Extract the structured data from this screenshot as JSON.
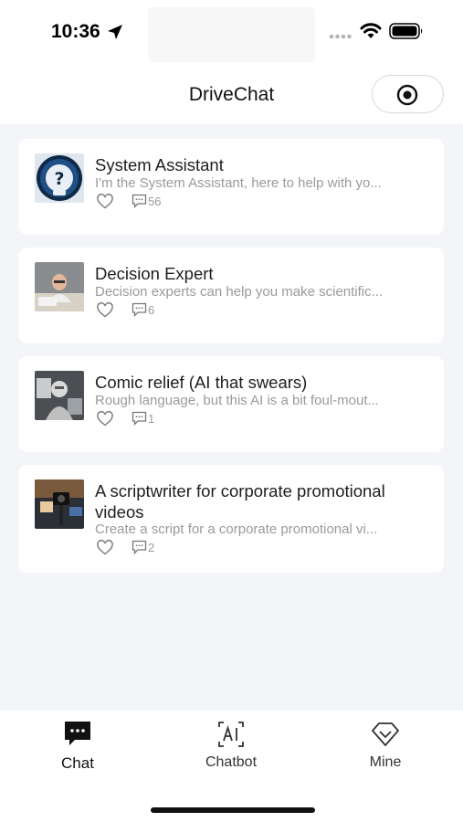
{
  "status_bar": {
    "time": "10:36"
  },
  "header": {
    "title": "DriveChat"
  },
  "bots": [
    {
      "title": "System Assistant",
      "description": "I'm the System Assistant, here to help with yo...",
      "comments": "56"
    },
    {
      "title": "Decision Expert",
      "description": "Decision experts can help you make scientific...",
      "comments": "6"
    },
    {
      "title": "Comic relief (AI that swears)",
      "description": "Rough language, but this AI is a bit foul-mout...",
      "comments": "1"
    },
    {
      "title": "A scriptwriter for corporate promotional videos",
      "description": "Create a script for a corporate promotional vi...",
      "comments": "2"
    }
  ],
  "tabs": [
    {
      "label": "Chat",
      "icon": "chat-bubble-icon",
      "active": true
    },
    {
      "label": "Chatbot",
      "icon": "ai-icon",
      "active": false
    },
    {
      "label": "Mine",
      "icon": "diamond-icon",
      "active": false
    }
  ],
  "colors": {
    "background": "#f3f5f9",
    "card": "#ffffff",
    "muted_text": "#9a9a9a",
    "active_tab": "#111111"
  }
}
